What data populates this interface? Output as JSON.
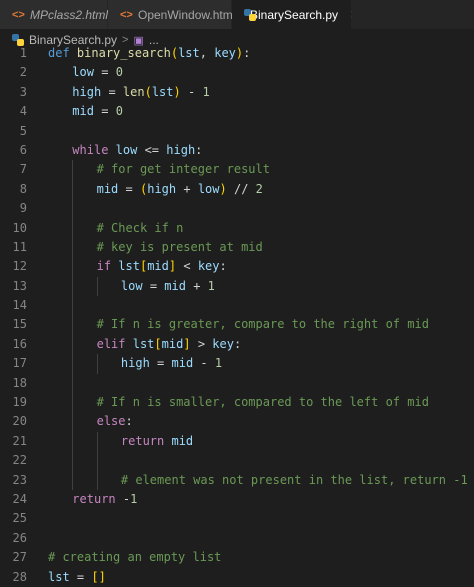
{
  "tabs": [
    {
      "label": "MPclass2.html",
      "icon": "html-file-icon"
    },
    {
      "label": "OpenWindow.html",
      "icon": "html-file-icon"
    },
    {
      "label": "BinarySearch.py",
      "icon": "python-file-icon",
      "active": true,
      "close": "✕"
    }
  ],
  "breadcrumb": {
    "file": "BinarySearch.py",
    "separator": ">",
    "symbol": "..."
  },
  "editor": {
    "line_numbers": [
      "1",
      "2",
      "3",
      "4",
      "5",
      "6",
      "7",
      "8",
      "9",
      "10",
      "11",
      "12",
      "13",
      "14",
      "15",
      "16",
      "17",
      "18",
      "19",
      "20",
      "21",
      "22",
      "23",
      "24",
      "25",
      "26",
      "27",
      "28"
    ],
    "lines": [
      "def binary_search(lst, key):",
      "low = 0",
      "high = len(lst) - 1",
      "mid = 0",
      "",
      "while low <= high:",
      "# for get integer result",
      "mid = (high + low) // 2",
      "",
      "# Check if n",
      "# key is present at mid",
      "if lst[mid] < key:",
      "low = mid + 1",
      "",
      "# If n is greater, compare to the right of mid",
      "elif lst[mid] > key:",
      "high = mid - 1",
      "",
      "# If n is smaller, compared to the left of mid",
      "else:",
      "return mid",
      "",
      "# element was not present in the list, return -1",
      "return -1",
      "",
      "",
      "# creating an empty list",
      "lst = []"
    ]
  },
  "colors": {
    "background": "#1e1e1e",
    "keyword": "#c586c0",
    "def": "#569cd6",
    "function": "#dcdcaa",
    "variable": "#9cdcfe",
    "number": "#b5cea8",
    "comment": "#6a9955"
  }
}
